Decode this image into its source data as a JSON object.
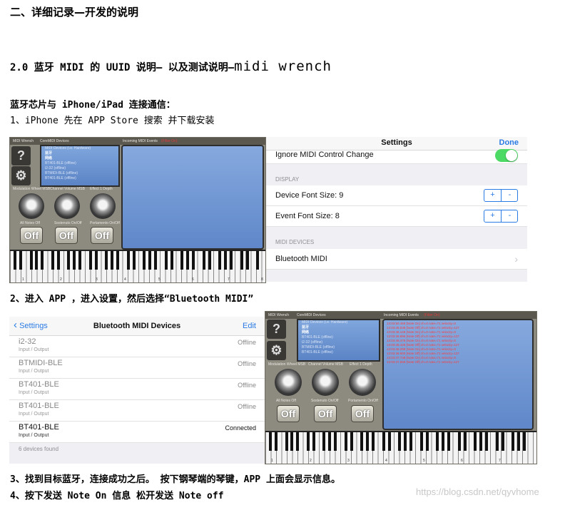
{
  "heading": "二、详细记录—开发的说明",
  "section": {
    "prefix": "2.0 蓝牙 MIDI 的 UUID 说明— 以及测试说明—",
    "highlight": "midi wrench"
  },
  "para1": "蓝牙芯片与 iPhone/iPad 连接通信：",
  "step1": "1、iPhone 先在 APP Store 搜索  并下载安装",
  "step2": "2、进入 APP ，进入设置，然后选择“Bluetooth MIDI”",
  "step3": "3、找到目标蓝牙，连接成功之后。   按下钢琴端的琴键，APP 上面会显示信息。",
  "step4": "4、按下发送 Note On 信息   松开发送 Note off",
  "watermark": "https://blog.csdn.net/qyvhome",
  "synth": {
    "app_title": "MIDI Wrench",
    "devices_label": "CoreMIDI Devices",
    "events_label": "Incoming MIDI Events",
    "filter_label": "(Filter On)",
    "help_glyph": "?",
    "gear_glyph": "⚙",
    "device_list": [
      "MIDI Devices (i.e. Hardware)",
      "蓝牙",
      "网络",
      "BT401-BLE (offline)",
      "i2-32 (offline)",
      "BTMIDI-BLE (offline)",
      "BT401-BLE (offline)",
      "BT401-BLE (online)"
    ],
    "knob_labels": [
      "Modulation Wheel MSB",
      "Channel Volume MSB",
      "Effect 1 Depth"
    ],
    "switch_labels": [
      "All Notes Off",
      "Sostenuto On/Off",
      "Portamento On/Off"
    ],
    "off_label": "Off",
    "octaves": [
      "1",
      "2",
      "3",
      "4",
      "5",
      "6",
      "7",
      "8"
    ],
    "events": [
      "13:03:50.469 [Note On] ch=0 note=71 velocity=0",
      "13:03:48.538 [Note Off] ch=0 note=71 velocity=127",
      "13:03:48.149 [Note On] ch=0 note=71 velocity=0",
      "13:03:48.896 [Note Off] ch=0 note=71 velocity=127",
      "13:03:48.378 [Note On] ch=0 note=71 velocity=0",
      "13:03:48.428 [Note Off] ch=0 note=71 velocity=127",
      "13:03:48.298 [Note On] ch=0 note=71 velocity=0",
      "13:03:48.600 [Note Off] ch=0 note=71 velocity=127",
      "13:03:47.738 [Note On] ch=0 note=71 velocity=0",
      "13:03:47.559 [Note Off] ch=0 note=71 velocity=127"
    ]
  },
  "settings": {
    "title": "Settings",
    "done": "Done",
    "ignore": "Ignore MIDI Control Change",
    "display_header": "DISPLAY",
    "device_font": "Device Font Size: 9",
    "event_font": "Event Font Size: 8",
    "plus": "+",
    "minus": "-",
    "midi_header": "MIDI DEVICES",
    "bt_midi": "Bluetooth MIDI",
    "chevron": "›"
  },
  "btmidi": {
    "back": "Settings",
    "title": "Bluetooth MIDI Devices",
    "edit": "Edit",
    "sub": "Input / Output",
    "devices": [
      {
        "name": "i2-32",
        "status": "Offline"
      },
      {
        "name": "BTMIDI-BLE",
        "status": "Offline"
      },
      {
        "name": "BT401-BLE",
        "status": "Offline"
      },
      {
        "name": "BT401-BLE",
        "status": "Offline"
      },
      {
        "name": "BT401-BLE",
        "status": "Connected"
      }
    ],
    "found": "6 devices found"
  }
}
